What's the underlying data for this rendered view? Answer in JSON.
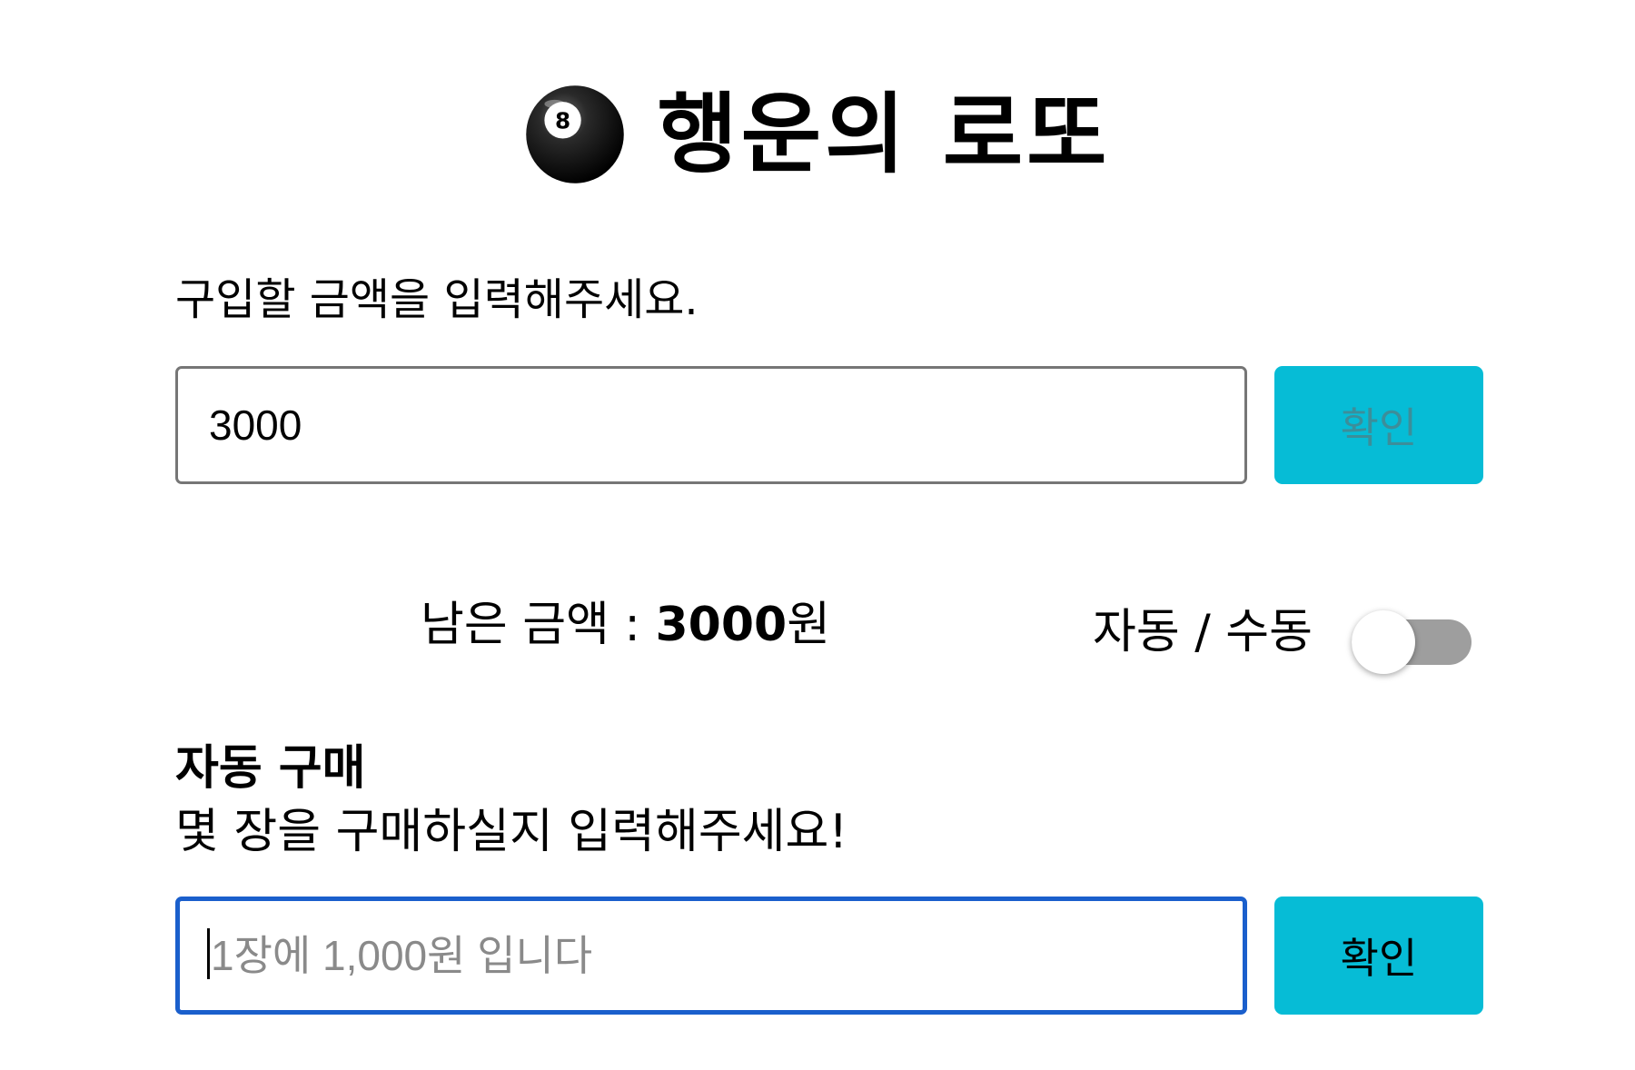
{
  "header": {
    "icon": "billiard-8-ball-icon",
    "title": "행운의 로또"
  },
  "purchase": {
    "label": "구입할 금액을 입력해주세요.",
    "amount_value": "3000",
    "confirm_label": "확인"
  },
  "status": {
    "remaining_label": "남은 금액 : ",
    "remaining_amount": "3000",
    "remaining_unit": "원",
    "mode_label": "자동 / 수동",
    "mode_toggle_on": false
  },
  "auto_purchase": {
    "heading": "자동 구매",
    "description": "몇 장을 구매하실지 입력해주세요!",
    "count_placeholder": "1장에 1,000원 입니다",
    "count_value": "",
    "confirm_label": "확인"
  },
  "colors": {
    "button_bg": "#06bcd6",
    "focus_border": "#1a5fcc",
    "toggle_track": "#9e9e9e"
  }
}
